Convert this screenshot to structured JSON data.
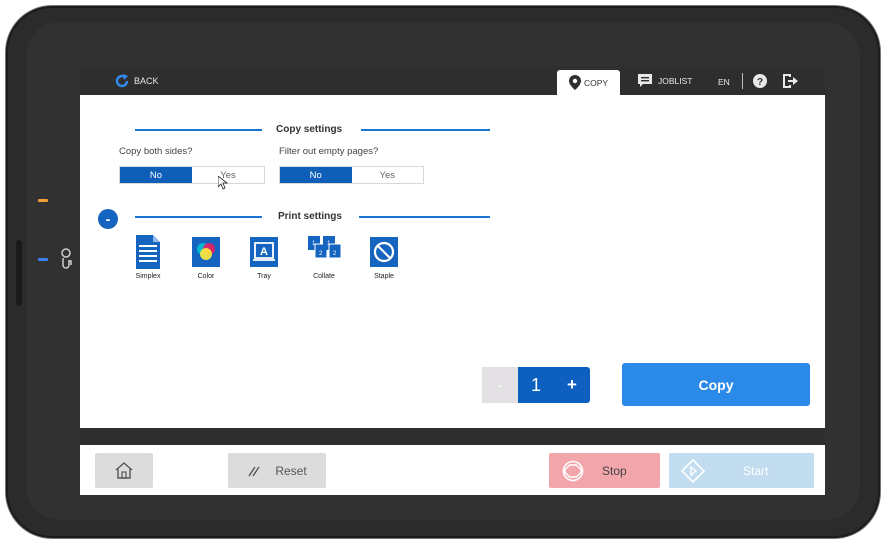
{
  "topbar": {
    "back_label": "BACK",
    "copy_tab_label": "COPY",
    "joblist_tab_label": "JOBLIST",
    "language": "EN"
  },
  "copy_settings": {
    "title": "Copy settings",
    "both_sides": {
      "label": "Copy both sides?",
      "options": [
        "No",
        "Yes"
      ],
      "selected": "No"
    },
    "empty_pages": {
      "label": "Filter out empty pages?",
      "options": [
        "No",
        "Yes"
      ],
      "selected": "No"
    }
  },
  "print_settings": {
    "title": "Print settings",
    "collapse_symbol": "-",
    "items": [
      {
        "label": "Simplex",
        "icon": "simplex-icon"
      },
      {
        "label": "Color",
        "icon": "color-icon"
      },
      {
        "label": "Tray",
        "icon": "tray-icon"
      },
      {
        "label": "Collate",
        "icon": "collate-icon"
      },
      {
        "label": "Staple",
        "icon": "staple-icon"
      }
    ]
  },
  "quantity": {
    "minus": "-",
    "value": "1",
    "plus": "+"
  },
  "copy_button": "Copy",
  "bottom": {
    "reset_label": "Reset",
    "stop_label": "Stop",
    "start_label": "Start"
  },
  "colors": {
    "accent": "#0d5fc0",
    "copy_button": "#2b8ae8",
    "stop": "#f2a6ac",
    "start_disabled": "#c2dcf0"
  }
}
